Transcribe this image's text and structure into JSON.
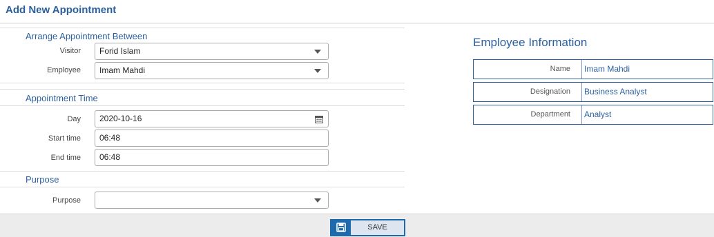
{
  "page": {
    "title": "Add New Appointment"
  },
  "sections": {
    "arrange": "Arrange Appointment Between",
    "time": "Appointment Time",
    "purpose": "Purpose"
  },
  "form": {
    "visitor": {
      "label": "Visitor",
      "value": "Forid Islam"
    },
    "employee": {
      "label": "Employee",
      "value": "Imam Mahdi"
    },
    "day": {
      "label": "Day",
      "value": "2020-10-16"
    },
    "start_time": {
      "label": "Start time",
      "value": "06:48"
    },
    "end_time": {
      "label": "End time",
      "value": "06:48"
    },
    "purpose": {
      "label": "Purpose",
      "value": ""
    }
  },
  "employee_info": {
    "title": "Employee Information",
    "rows": [
      {
        "key": "Name",
        "value": "Imam Mahdi"
      },
      {
        "key": "Designation",
        "value": "Business Analyst"
      },
      {
        "key": "Department",
        "value": "Analyst"
      }
    ]
  },
  "footer": {
    "save_label": "SAVE"
  },
  "icons": {
    "save": "floppy-disk-icon",
    "calendar": "calendar-icon",
    "dropdown": "chevron-down-icon"
  },
  "colors": {
    "accent": "#2b5f9e",
    "button_border": "#1f6aad"
  }
}
